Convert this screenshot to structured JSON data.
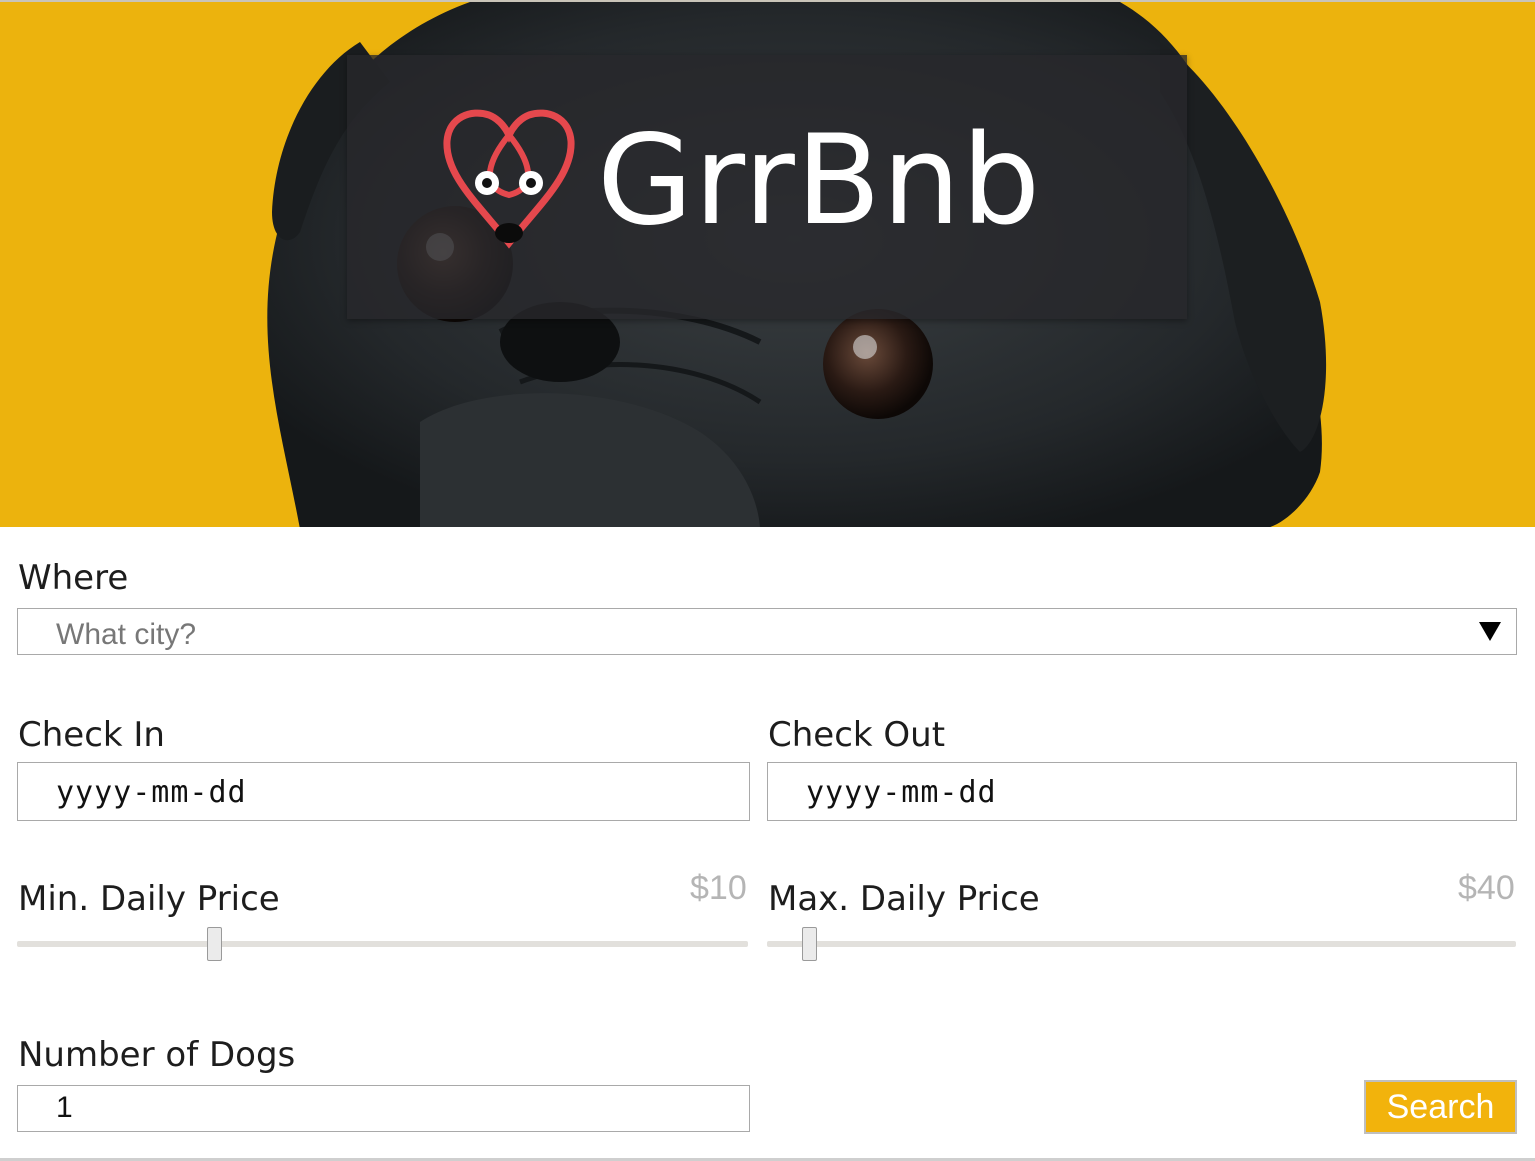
{
  "brand": {
    "name": "GrrBnb",
    "logo_icon": "dog-heart-logo-icon"
  },
  "hero": {
    "image": "pug-photo",
    "background": "#ecb30d"
  },
  "search_form": {
    "where": {
      "label": "Where",
      "placeholder": "What city?",
      "icon": "caret-down-icon"
    },
    "check_in": {
      "label": "Check In",
      "placeholder": "yyyy-mm-dd"
    },
    "check_out": {
      "label": "Check Out",
      "placeholder": "yyyy-mm-dd"
    },
    "min_price": {
      "label": "Min. Daily Price",
      "display": "$10",
      "value": 10
    },
    "max_price": {
      "label": "Max. Daily Price",
      "display": "$40",
      "value": 40
    },
    "dogs": {
      "label": "Number of Dogs",
      "value": "1"
    },
    "search_button": {
      "label": "Search",
      "color": "#f2b30c"
    }
  }
}
